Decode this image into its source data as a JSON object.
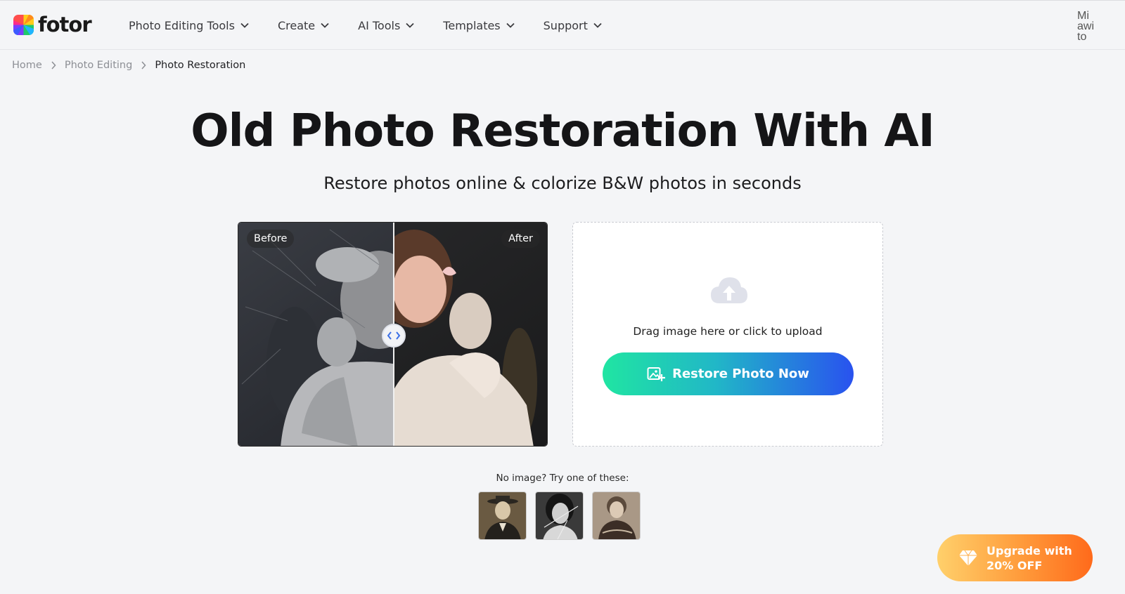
{
  "header": {
    "logo_text": "fotor",
    "nav": [
      {
        "label": "Photo Editing Tools"
      },
      {
        "label": "Create"
      },
      {
        "label": "AI Tools"
      },
      {
        "label": "Templates"
      },
      {
        "label": "Support"
      }
    ],
    "avatar_alt": "Mi awi to"
  },
  "breadcrumb": {
    "home": "Home",
    "photo_editing": "Photo Editing",
    "current": "Photo Restoration"
  },
  "hero": {
    "title": "Old Photo Restoration With AI",
    "subtitle": "Restore photos online & colorize B&W photos in seconds"
  },
  "compare": {
    "before_label": "Before",
    "after_label": "After",
    "slider_position": 0.5
  },
  "upload": {
    "text": "Drag image here or click to upload",
    "button_label": "Restore Photo Now"
  },
  "samples": {
    "label": "No image? Try one of these:"
  },
  "upgrade": {
    "line1": "Upgrade with",
    "line2": "20% OFF"
  },
  "colors": {
    "accent_start": "#20e5a2",
    "accent_end": "#2952ef",
    "upgrade_start": "#ffd06b",
    "upgrade_end": "#ff6a1b"
  }
}
